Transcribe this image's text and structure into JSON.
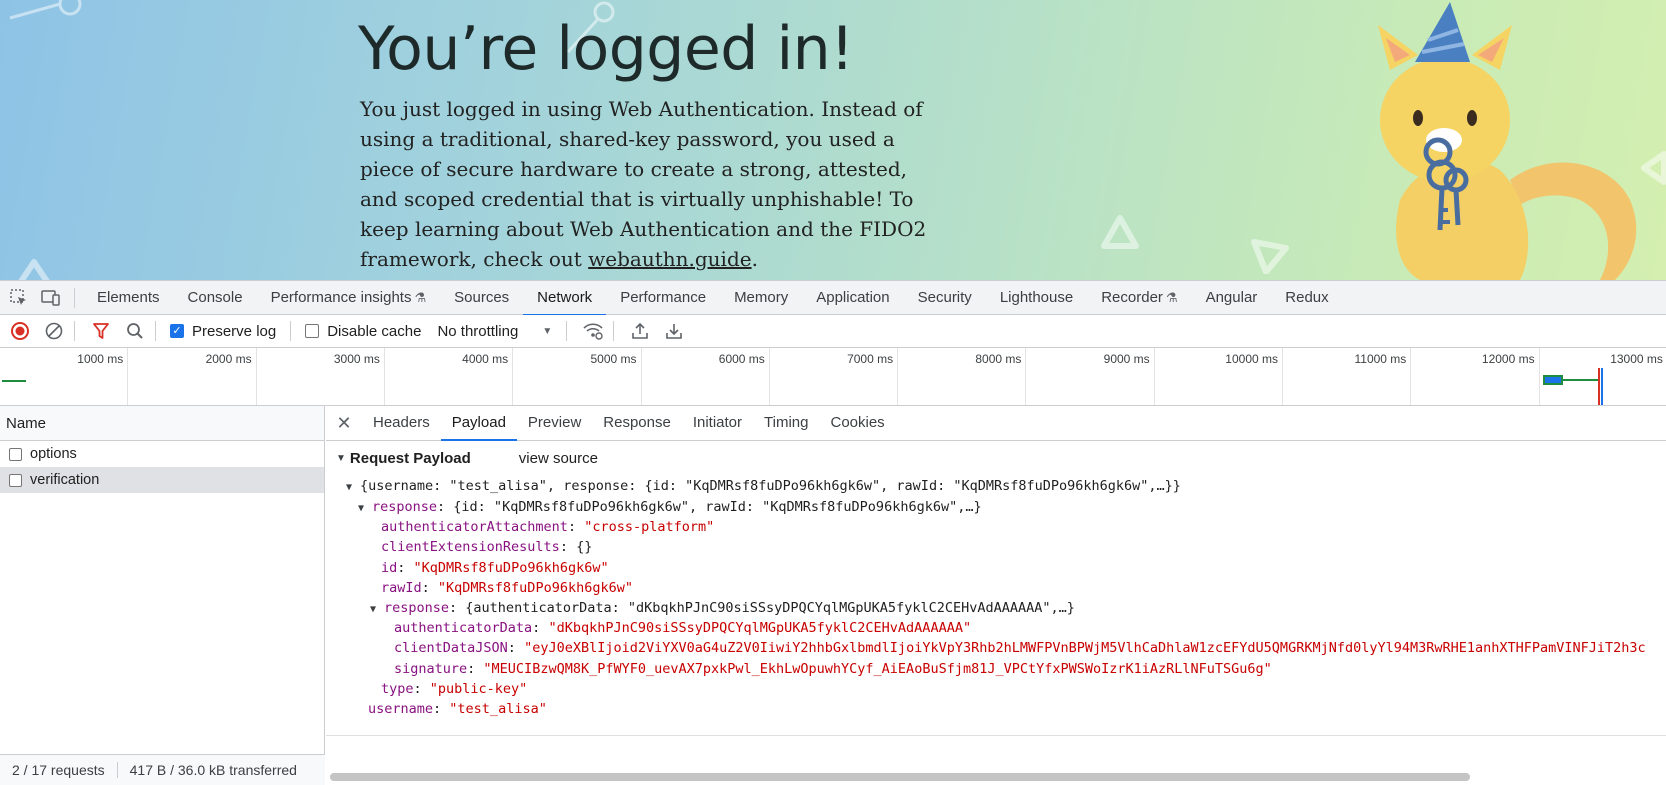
{
  "page": {
    "heading": "You’re logged in!",
    "paragraph_before_link": "You just logged in using Web Authentication. Instead of using a traditional, shared-key password, you used a piece of secure hardware to create a strong, attested, and scoped credential that is virtually unphishable! To keep learning about Web Authentication and the FIDO2 framework, check out ",
    "link_text": "webauthn.guide",
    "paragraph_after_link": "."
  },
  "devtools": {
    "tabs": [
      {
        "label": "Elements"
      },
      {
        "label": "Console"
      },
      {
        "label": "Performance insights",
        "flask": true
      },
      {
        "label": "Sources"
      },
      {
        "label": "Network",
        "active": true
      },
      {
        "label": "Performance"
      },
      {
        "label": "Memory"
      },
      {
        "label": "Application"
      },
      {
        "label": "Security"
      },
      {
        "label": "Lighthouse"
      },
      {
        "label": "Recorder",
        "flask": true
      },
      {
        "label": "Angular"
      },
      {
        "label": "Redux"
      }
    ],
    "toolbar": {
      "preserve_log_label": "Preserve log",
      "preserve_log_checked": true,
      "disable_cache_label": "Disable cache",
      "disable_cache_checked": false,
      "throttling_value": "No throttling"
    },
    "timeline_ticks": [
      "1000 ms",
      "2000 ms",
      "3000 ms",
      "4000 ms",
      "5000 ms",
      "6000 ms",
      "7000 ms",
      "8000 ms",
      "9000 ms",
      "10000 ms",
      "11000 ms",
      "12000 ms",
      "13000 ms"
    ],
    "requests": {
      "column_header": "Name",
      "rows": [
        {
          "name": "options",
          "selected": false
        },
        {
          "name": "verification",
          "selected": true
        }
      ],
      "status_requests": "2 / 17 requests",
      "status_transferred": "417 B / 36.0 kB transferred"
    },
    "detail_tabs": [
      "Headers",
      "Payload",
      "Preview",
      "Response",
      "Initiator",
      "Timing",
      "Cookies"
    ],
    "active_detail_tab": "Payload",
    "payload": {
      "section_title": "Request Payload",
      "view_source": "view source",
      "summary": "{username: \"test_alisa\", response: {id: \"KqDMRsf8fuDPo96kh6gk6w\", rawId: \"KqDMRsf8fuDPo96kh6gk6w\",…}}",
      "response_key": "response",
      "response_summary": "{id: \"KqDMRsf8fuDPo96kh6gk6w\", rawId: \"KqDMRsf8fuDPo96kh6gk6w\",…}",
      "authenticatorAttachment_key": "authenticatorAttachment",
      "authenticatorAttachment_val": "\"cross-platform\"",
      "clientExtensionResults_key": "clientExtensionResults",
      "clientExtensionResults_val": "{}",
      "id_key": "id",
      "id_val": "\"KqDMRsf8fuDPo96kh6gk6w\"",
      "rawId_key": "rawId",
      "rawId_val": "\"KqDMRsf8fuDPo96kh6gk6w\"",
      "inner_response_key": "response",
      "inner_response_summary": "{authenticatorData: \"dKbqkhPJnC90siSSsyDPQCYqlMGpUKA5fyklC2CEHvAdAAAAAA\",…}",
      "authenticatorData_key": "authenticatorData",
      "authenticatorData_val": "\"dKbqkhPJnC90siSSsyDPQCYqlMGpUKA5fyklC2CEHvAdAAAAAA\"",
      "clientDataJSON_key": "clientDataJSON",
      "clientDataJSON_val": "\"eyJ0eXBlIjoid2ViYXV0aG4uZ2V0IiwiY2hhbGxlbmdlIjoiYkVpY3Rhb2hLMWFPVnBPWjM5VlhCaDhlaW1zcEFYdU5QMGRKMjNfd0lyYl94M3RwRHE1anhXTHFPamVINFJiT2h3c",
      "signature_key": "signature",
      "signature_val": "\"MEUCIBzwQM8K_PfWYF0_uevAX7pxkPwl_EkhLwOpuwhYCyf_AiEAoBuSfjm81J_VPCtYfxPWSWoIzrK1iAzRLlNFuTSGu6g\"",
      "type_key": "type",
      "type_val": "\"public-key\"",
      "username_key": "username",
      "username_val": "\"test_alisa\""
    }
  },
  "colors": {
    "accent": "#1a73e8",
    "json_key": "#881280",
    "json_string": "#c80000",
    "record_red": "#d93025",
    "filter_red": "#d93025"
  }
}
